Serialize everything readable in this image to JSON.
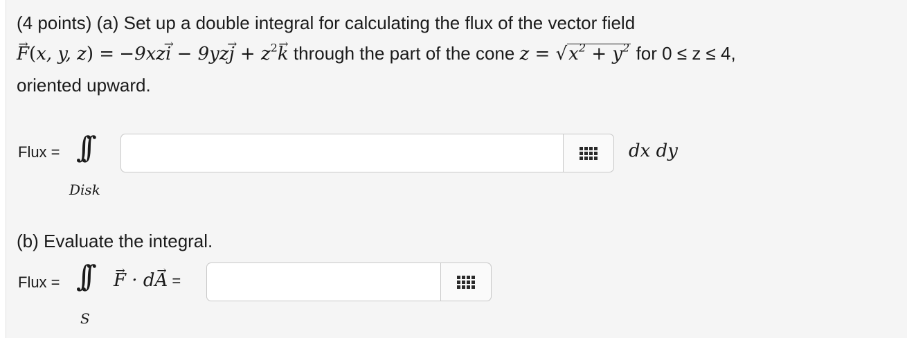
{
  "problem": {
    "header": "(4 points) (a) Set up a double integral for calculating the flux of the vector field",
    "field_lhs": "F(x, y, z) =",
    "field_rhs_1": "−9xz",
    "field_i": "i",
    "field_rhs_2": " − 9yz",
    "field_j": "j",
    "field_rhs_3": " + z",
    "field_exp": "2",
    "field_k": "k",
    "through_text": " through the part of the cone ",
    "cone_lhs": "z = √",
    "cone_rad_1": "x",
    "cone_rad_2": " + y",
    "cone_exp": "2",
    "for_text": " for ",
    "range_text": "0 ≤ z ≤ 4,",
    "orientation": "oriented upward."
  },
  "part_a": {
    "flux_label": "Flux =",
    "integral_symbol": "∫∫",
    "region": "Disk",
    "input_value": "",
    "differential": "dx dy"
  },
  "part_b": {
    "title": "(b) Evaluate the integral.",
    "flux_label": "Flux =",
    "integral_symbol": "∫∫",
    "integrand_f": "F",
    "integrand_dot": " · d",
    "integrand_a": "A",
    "equals": " =",
    "region": "S",
    "input_value": ""
  }
}
